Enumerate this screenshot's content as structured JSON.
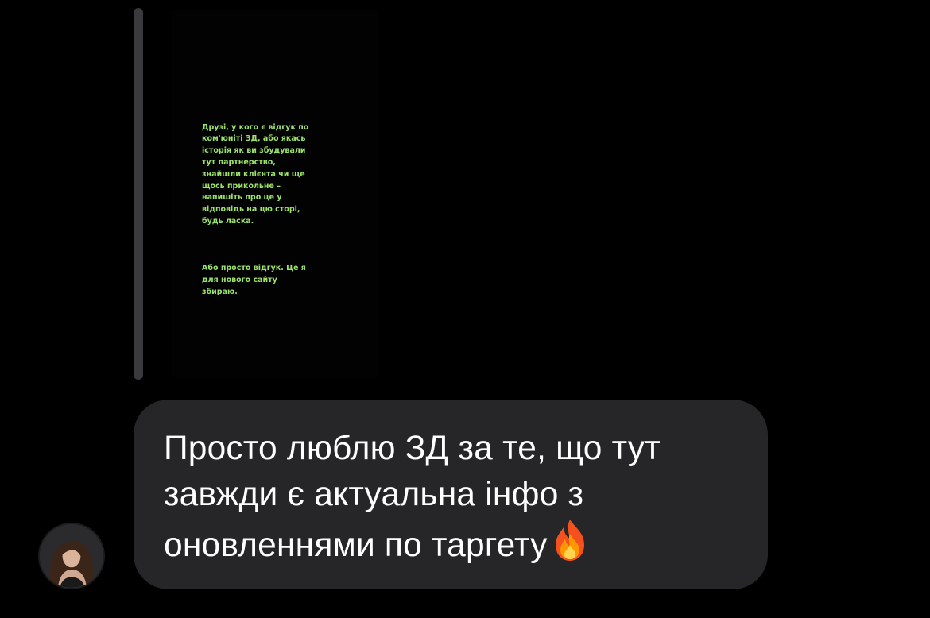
{
  "story_reply": {
    "text_paragraph_1": "Друзі, у кого є відгук по ком'юніті ЗД, або якась історія як ви збудували тут партнерство, знайшли клієнта чи ще щось прикольне – напишіть про це у відповідь на цю сторі, будь ласка.",
    "text_paragraph_2": "Або просто відгук. Це я для нового сайту збираю.",
    "text_color": "#9be36a"
  },
  "message": {
    "text": "Просто люблю ЗД за те, що тут завжди є актуальна інфо з оновленнями по таргету",
    "emoji": "fire-emoji",
    "bubble_color": "#262628"
  },
  "sender": {
    "avatar_icon": "avatar"
  }
}
